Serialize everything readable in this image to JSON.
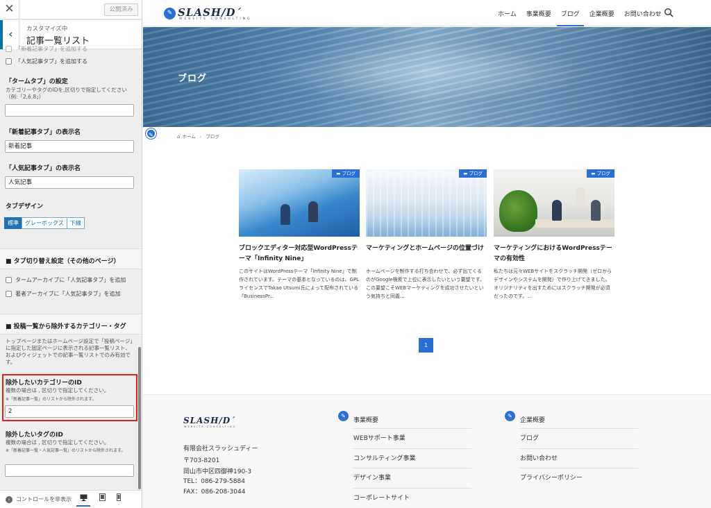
{
  "sidebar": {
    "close": "✕",
    "publish_label": "公開済み",
    "back": "‹",
    "subtitle": "カスタマイズ中",
    "title": "記事一覧リスト",
    "cut_checkbox_label": "「新着記事タブ」を追加する",
    "popular_tab_checkbox": "「人気記事タブ」を追加する",
    "term_tab_heading": "「タームタブ」の設定",
    "term_tab_desc": "カテゴリーやタグのIDを,区切りで指定してください（例:「2,6,8」）",
    "term_tab_value": "",
    "new_tab_name_heading": "「新着記事タブ」の表示名",
    "new_tab_name_value": "新着記事",
    "popular_tab_name_heading": "「人気記事タブ」の表示名",
    "popular_tab_name_value": "人気記事",
    "tab_design_heading": "タブデザイン",
    "tab_design_options": [
      "標準",
      "グレーボックス",
      "下線"
    ],
    "tab_switch_section": "■ タブ切り替え設定（その他のページ）",
    "term_archive_checkbox": "タームアーカイブに「人気記事タブ」を追加",
    "author_archive_checkbox": "著者アーカイブに「人気記事タブ」を追加",
    "exclude_section": "■ 投稿一覧から除外するカテゴリー・タグ",
    "exclude_desc": "トップページまたはホームページ設定で「投稿ページ」に指定した固定ページに表示される記事一覧リスト、およびウィジェットでの記事一覧リストでのみ有効です。",
    "exclude_cat_heading": "除外したいカテゴリーのID",
    "exclude_cat_desc": "複数の場合は , 区切りで指定してください。",
    "exclude_cat_note": "※「新着記事一覧」のリストから除外されます。",
    "exclude_cat_value": "2",
    "exclude_tag_heading": "除外したいタグのID",
    "exclude_tag_desc": "複数の場合は , 区切りで指定してください。",
    "exclude_tag_note": "※「新着記事一覧・人気記事一覧」のリストから除外されます。",
    "exclude_tag_value": "",
    "hide_controls": "コントロールを非表示",
    "device_icons": [
      "desktop-icon",
      "tablet-icon",
      "mobile-icon"
    ]
  },
  "site": {
    "logo_text": "SLASH/D´",
    "logo_tagline": "WEBSITE CONSULTING",
    "nav": [
      "ホーム",
      "事業概要",
      "ブログ",
      "企業概要",
      "お問い合わせ"
    ],
    "active_nav": "ブログ",
    "hero_title": "ブログ",
    "breadcrumb": [
      "ホーム",
      "ブログ"
    ],
    "posts": [
      {
        "badge": "ブログ",
        "title": "ブロックエディター対応型WordPressテーマ「Infinity Nine」",
        "excerpt": "このサイトはWordPressテーマ「Infinity Nine」で制作されています。テーマの基本となっているのは、GPLライセンスでTakao Utsumi氏によって配布されている『BusinessPr..."
      },
      {
        "badge": "ブログ",
        "title": "マーケティングとホームページの位置づけ",
        "excerpt": "ホームページを制作する打ち合わせで、必ず出てくるのがGoogle検索で上位に表示したいという要望です。この要望こそWEBマーケティングを成功させたいという気持ちと同義..."
      },
      {
        "badge": "ブログ",
        "title": "マーケティングにおけるWordPressテーマの有効性",
        "excerpt": "私たちは元々WEBサイトをスクラッチ開発（ゼロからデザインやシステムを開発）で作り上げてきました。オリジナリティを出すためにはスクラッチ開発が必須だったのです。..."
      }
    ],
    "pager_current": "1",
    "footer": {
      "company": "有限会社スラッシュディー",
      "zip": "〒703-8201",
      "address": "岡山市中区四御神190-3",
      "tel": "TEL：086-279-5884",
      "fax": "FAX：086-208-3044",
      "col1_title": "事業概要",
      "col1_links": [
        "WEBサポート事業",
        "コンサルティング事業",
        "デザイン事業",
        "コーポレートサイト"
      ],
      "col2_title": "企業概要",
      "col2_links": [
        "ブログ",
        "お問い合わせ",
        "プライバシーポリシー"
      ]
    }
  },
  "colors": {
    "accent": "#2b6fd6",
    "wp_blue": "#0073aa",
    "highlight": "#e02020"
  }
}
